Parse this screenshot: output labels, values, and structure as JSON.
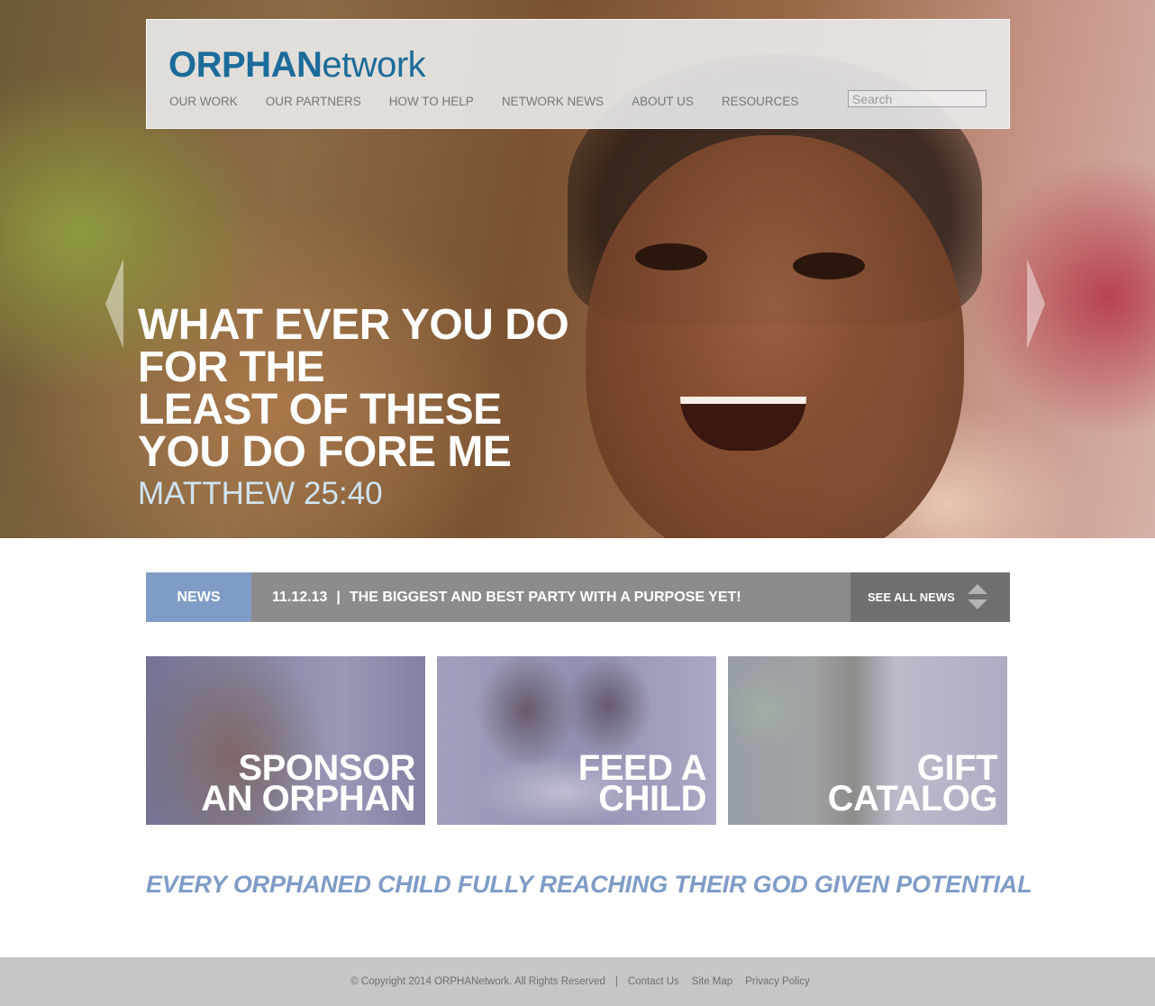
{
  "header": {
    "logo_bold": "ORPHAN",
    "logo_light": "etwork",
    "nav": [
      "OUR WORK",
      "OUR PARTNERS",
      "HOW TO HELP",
      "NETWORK NEWS",
      "ABOUT US",
      "RESOURCES"
    ],
    "search_placeholder": "Search"
  },
  "hero": {
    "quote_lines": [
      "WHAT EVER YOU DO",
      "FOR THE",
      "LEAST OF THESE",
      "YOU DO FORE ME"
    ],
    "reference": "MATTHEW 25:40",
    "prev_icon": "chevron-left-icon",
    "next_icon": "chevron-right-icon"
  },
  "news": {
    "label": "NEWS",
    "date": "11.12.13",
    "separator": "|",
    "headline": "THE BIGGEST AND BEST PARTY WITH A PURPOSE YET!",
    "see_all": "SEE ALL NEWS",
    "arrows_icon": "up-down-arrows-icon"
  },
  "tiles": [
    {
      "lines": [
        "SPONSOR",
        "AN ORPHAN"
      ]
    },
    {
      "lines": [
        "FEED A",
        "CHILD"
      ]
    },
    {
      "lines": [
        "GIFT",
        "CATALOG"
      ]
    }
  ],
  "tagline": "EVERY ORPHANED CHILD FULLY REACHING THEIR GOD GIVEN POTENTIAL",
  "footer": {
    "copyright": "© Copyright 2014 ORPHANetwork. All Rights Reserved",
    "separator": "|",
    "links": [
      "Contact Us",
      "Site Map",
      "Privacy Policy"
    ]
  },
  "colors": {
    "brand_blue": "#1b6c9a",
    "accent_blue": "#7f9cc6",
    "news_gray": "#8c8c8c",
    "news_dark_gray": "#6f6f6f",
    "footer_gray": "#c6c6c6"
  }
}
